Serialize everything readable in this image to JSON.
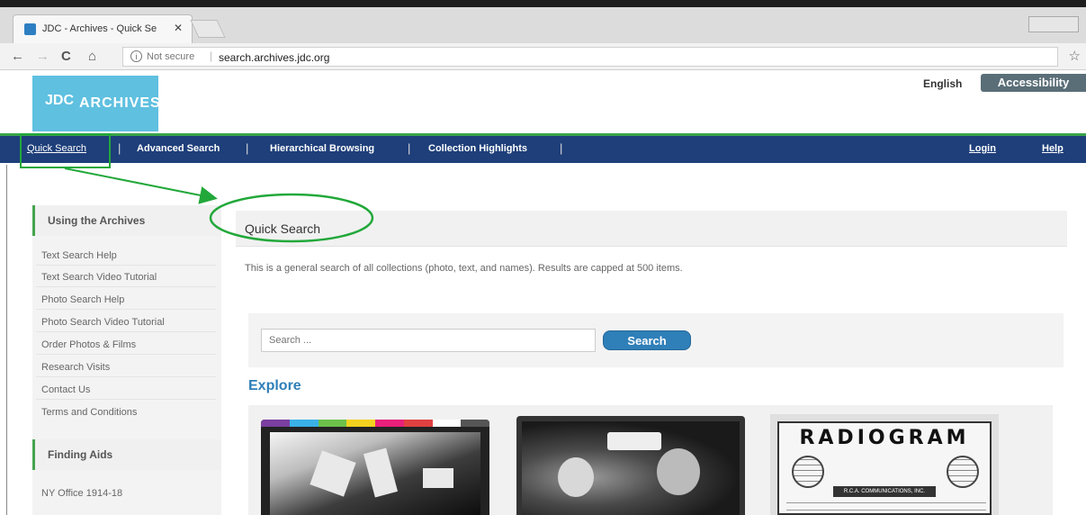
{
  "browser": {
    "tab_title": "JDC - Archives - Quick Se",
    "tab_close": "✕",
    "back": "←",
    "forward": "→",
    "reload": "C",
    "home": "⌂",
    "info_glyph": "i",
    "security": "Not secure",
    "url_separator": "|",
    "url": "search.archives.jdc.org",
    "bookmark": "☆"
  },
  "header": {
    "logo_mark": "JDC",
    "logo_text": "ARCHIVES",
    "language": "English",
    "accessibility": "Accessibility"
  },
  "nav": {
    "items": [
      "Quick Search",
      "Advanced Search",
      "Hierarchical Browsing",
      "Collection Highlights"
    ],
    "separator": "|",
    "login": "Login",
    "help": "Help"
  },
  "sidebar": {
    "heading1": "Using the Archives",
    "links": [
      "Text Search Help",
      "Text Search Video Tutorial",
      "Photo Search Help",
      "Photo Search Video Tutorial",
      "Order Photos & Films",
      "Research Visits",
      "Contact Us",
      "Terms and Conditions"
    ],
    "heading2": "Finding Aids",
    "finding_aids": [
      "NY Office 1914-18"
    ]
  },
  "main": {
    "title": "Quick Search",
    "description": "This is a general search of all collections (photo, text, and names). Results are capped at 500 items.",
    "search_placeholder": "Search ...",
    "search_button": "Search",
    "explore": "Explore",
    "radiogram_title": "RADIOGRAM",
    "radiogram_company": "R.C.A. COMMUNICATIONS, INC."
  },
  "colors": {
    "nav_bg": "#1e3f7a",
    "accent_green": "#39a44a",
    "logo_blue": "#5fc0e0",
    "button_blue": "#2f7fb8",
    "annotation_green": "#22a83a"
  },
  "thumb_strip_colors": [
    "#7a3fa0",
    "#3ab0e6",
    "#6cc04a",
    "#f2d21e",
    "#e8207a",
    "#e04040",
    "#ffffff",
    "#555555"
  ]
}
